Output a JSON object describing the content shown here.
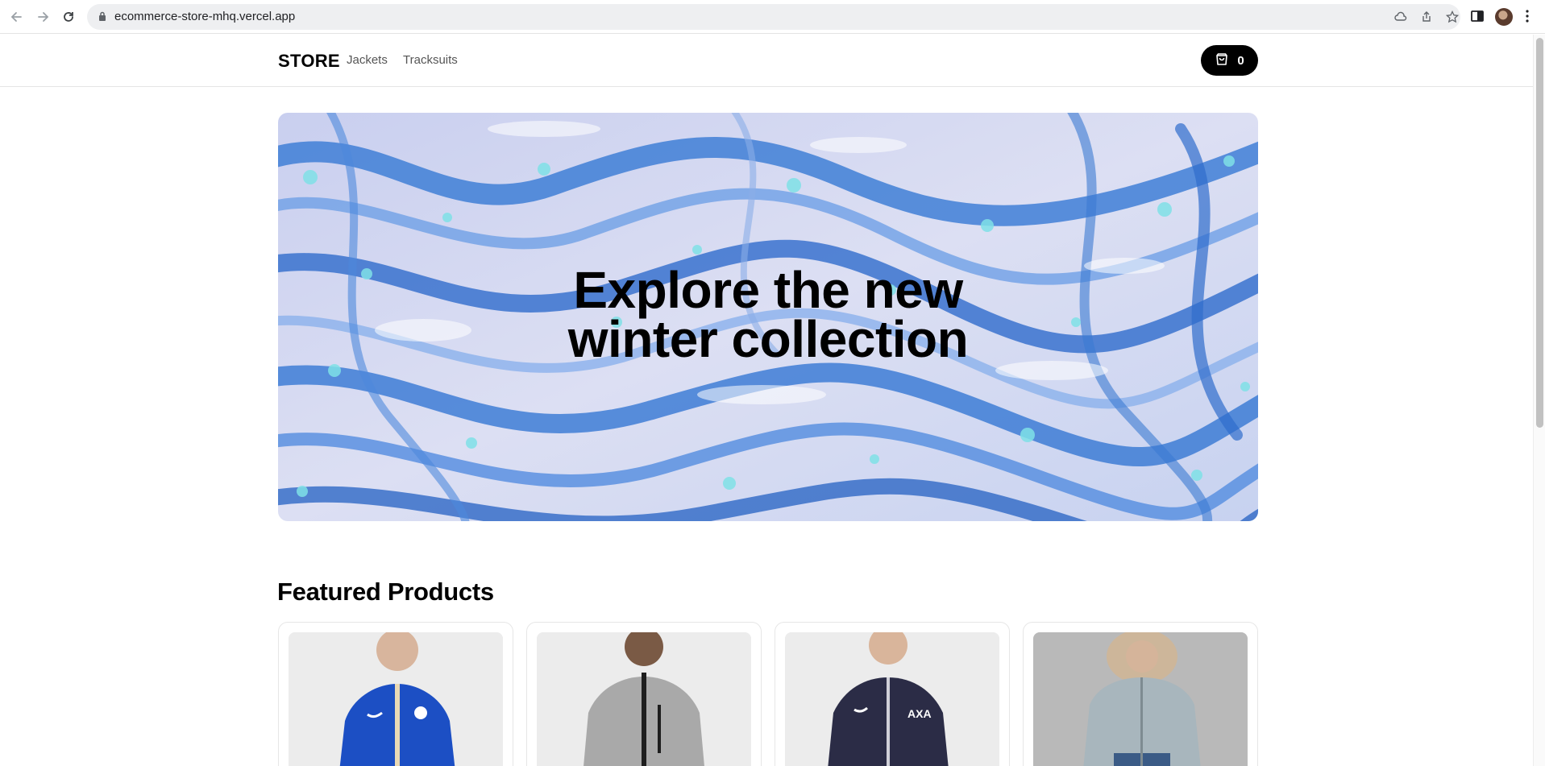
{
  "browser": {
    "url": "ecommerce-store-mhq.vercel.app"
  },
  "header": {
    "logo": "STORE",
    "nav": [
      {
        "label": "Jackets"
      },
      {
        "label": "Tracksuits"
      }
    ],
    "cart_count": "0"
  },
  "hero": {
    "title_line1": "Explore the new",
    "title_line2": "winter collection"
  },
  "featured": {
    "title": "Featured Products",
    "products": [
      {
        "image": "blue-track-jacket",
        "color": "#1c4fc4"
      },
      {
        "image": "grey-fleece-jacket",
        "color": "#a9a9a9"
      },
      {
        "image": "navy-track-jacket",
        "color": "#2b2c46"
      },
      {
        "image": "grey-parka-fur-hood",
        "color": "#a8b6bd"
      }
    ]
  },
  "colors": {
    "accent": "#000000",
    "hero_blue": "#3f7fd6",
    "hero_light": "#d9dcf2"
  }
}
